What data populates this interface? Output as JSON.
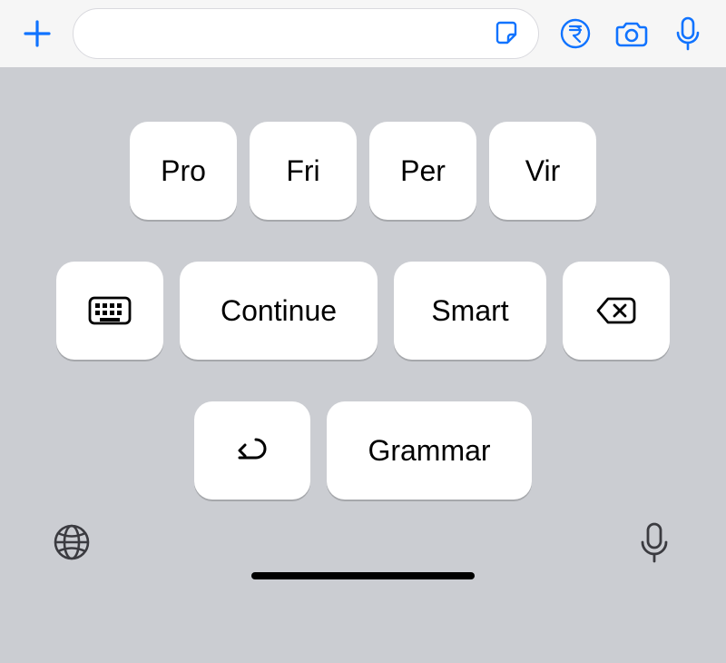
{
  "colors": {
    "accent": "#1073ff",
    "keyboard_bg": "#cbcdd2",
    "key_bg": "#ffffff",
    "top_bg": "#f6f6f6"
  },
  "top_bar": {
    "plus_icon": "plus",
    "input_value": "",
    "input_placeholder": "",
    "sticker_icon": "sticker",
    "rupee_icon": "rupee-circle",
    "camera_icon": "camera",
    "mic_icon": "microphone"
  },
  "keyboard": {
    "row1": [
      "Pro",
      "Fri",
      "Per",
      "Vir"
    ],
    "row2": {
      "keyboard_icon": "keyboard",
      "continue": "Continue",
      "smart": "Smart",
      "delete_icon": "delete"
    },
    "row3": {
      "undo_icon": "undo",
      "grammar": "Grammar"
    },
    "bottom": {
      "globe_icon": "globe",
      "mic_icon": "microphone"
    }
  }
}
